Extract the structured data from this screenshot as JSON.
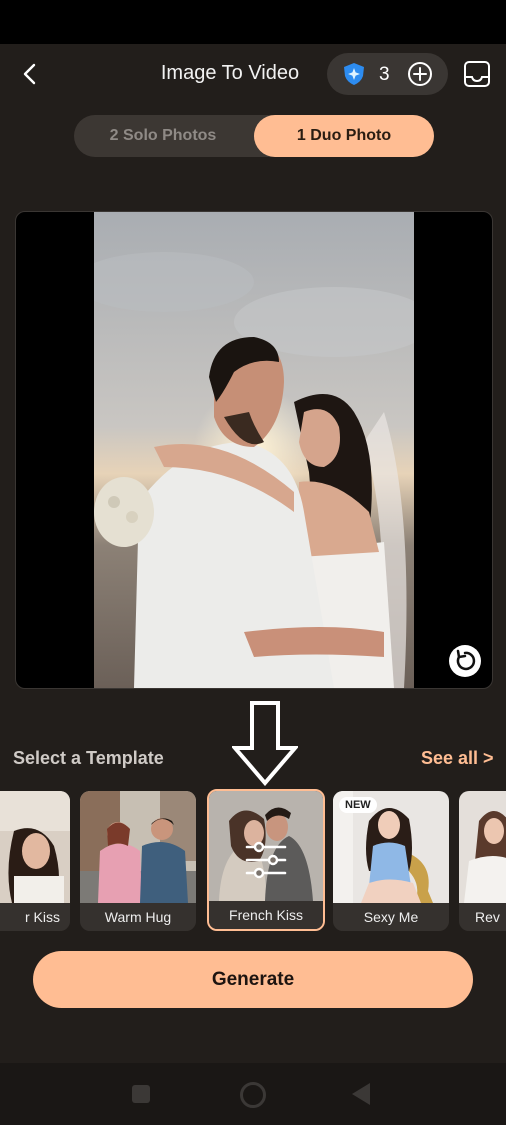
{
  "header": {
    "title": "Image To Video",
    "credits": "3",
    "back_icon": "chevron-left-icon",
    "inbox_icon": "inbox-icon"
  },
  "mode_tabs": [
    {
      "label": "2 Solo Photos",
      "active": false
    },
    {
      "label": "1 Duo Photo",
      "active": true
    }
  ],
  "templates": {
    "heading": "Select a Template",
    "see_all": "See all >",
    "items": [
      {
        "label": "r Kiss"
      },
      {
        "label": "Warm Hug"
      },
      {
        "label": "French Kiss",
        "selected": true
      },
      {
        "label": "Sexy Me",
        "badge": "NEW"
      },
      {
        "label": "Rev"
      }
    ]
  },
  "generate_label": "Generate",
  "colors": {
    "accent": "#ffbd93",
    "background": "#221e1b"
  }
}
